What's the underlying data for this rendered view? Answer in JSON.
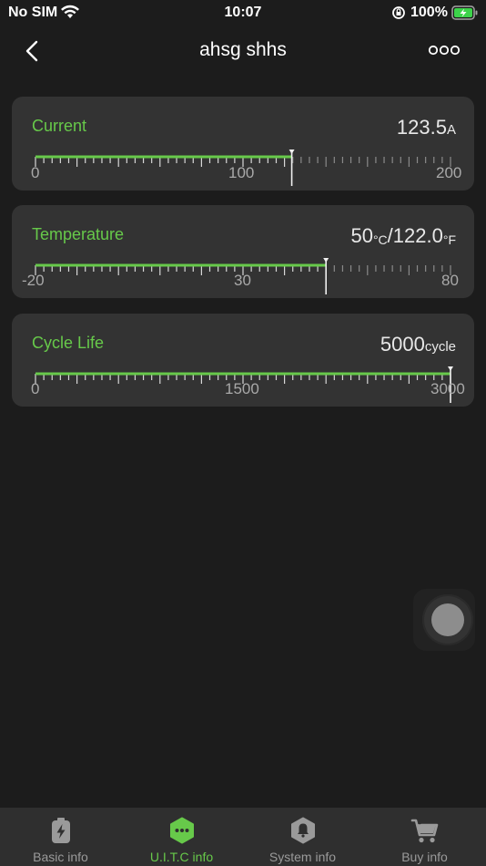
{
  "status_bar": {
    "carrier": "No SIM",
    "time": "10:07",
    "battery_percent": "100%"
  },
  "nav": {
    "title": "ahsg shhs"
  },
  "cards": [
    {
      "label": "Current",
      "value": "123.5",
      "unit": "A",
      "min_label": "0",
      "mid_label": "100",
      "max_label": "200",
      "min": 0,
      "max": 200,
      "level": 123.5
    },
    {
      "label": "Temperature",
      "value": "50",
      "unit": "°C",
      "separator": "/",
      "value2": "122.0",
      "unit2": "°F",
      "min_label": "-20",
      "mid_label": "30",
      "max_label": "80",
      "min": -20,
      "max": 80,
      "level": 50
    },
    {
      "label": "Cycle Life",
      "value": "5000",
      "unit": "cycle",
      "min_label": "0",
      "mid_label": "1500",
      "max_label": "3000",
      "min": 0,
      "max": 3000,
      "level": 3000
    }
  ],
  "tabs": [
    {
      "label": "Basic info",
      "icon": "battery-bolt-icon"
    },
    {
      "label": "U.I.T.C info",
      "icon": "chat-dots-icon"
    },
    {
      "label": "System info",
      "icon": "bell-icon"
    },
    {
      "label": "Buy info",
      "icon": "cart-icon"
    }
  ],
  "colors": {
    "accent": "#67c94a",
    "card": "#333333",
    "background": "#1c1c1c"
  }
}
